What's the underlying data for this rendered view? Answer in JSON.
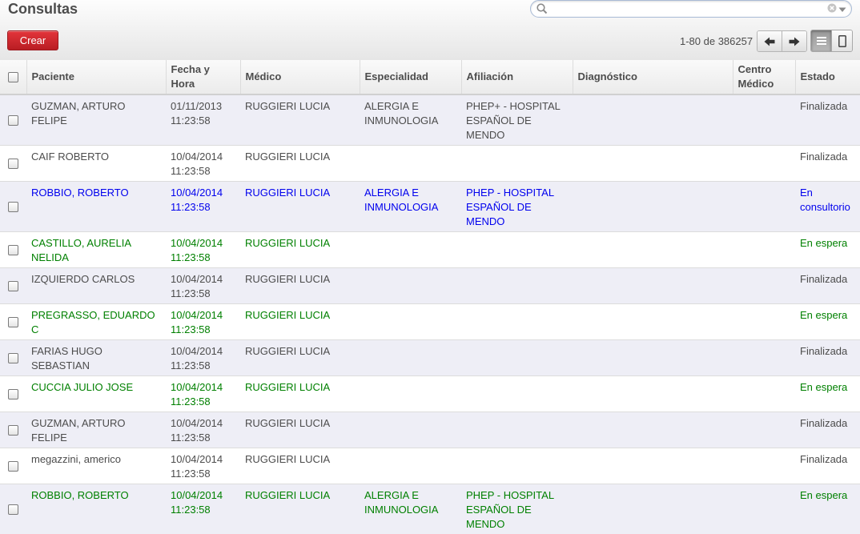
{
  "header": {
    "title": "Consultas",
    "create_label": "Crear",
    "pager": "1-80 de 386257"
  },
  "search": {
    "value": "",
    "placeholder": ""
  },
  "columns": [
    "Paciente",
    "Fecha y Hora",
    "Médico",
    "Especialidad",
    "Afiliación",
    "Diagnóstico",
    "Centro Médico",
    "Estado"
  ],
  "colors": {
    "finalizada": "#4c4c4c",
    "en_consultorio": "#0000ee",
    "en_espera": "#008000",
    "create_button": "#c9272d"
  },
  "rows": [
    {
      "paciente": "GUZMAN, ARTURO FELIPE",
      "fecha": "01/11/2013 11:23:58",
      "medico": "RUGGIERI LUCIA",
      "especialidad": "ALERGIA E INMUNOLOGIA",
      "afiliacion": "PHEP+ - HOSPITAL ESPAÑOL DE MENDO",
      "diagnostico": "",
      "centro": "",
      "estado": "Finalizada"
    },
    {
      "paciente": "CAIF ROBERTO",
      "fecha": "10/04/2014 11:23:58",
      "medico": "RUGGIERI LUCIA",
      "especialidad": "",
      "afiliacion": "",
      "diagnostico": "",
      "centro": "",
      "estado": "Finalizada"
    },
    {
      "paciente": "ROBBIO, ROBERTO",
      "fecha": "10/04/2014 11:23:58",
      "medico": "RUGGIERI LUCIA",
      "especialidad": "ALERGIA E INMUNOLOGIA",
      "afiliacion": "PHEP - HOSPITAL ESPAÑOL DE MENDO",
      "diagnostico": "",
      "centro": "",
      "estado": "En consultorio"
    },
    {
      "paciente": "CASTILLO, AURELIA NELIDA",
      "fecha": "10/04/2014 11:23:58",
      "medico": "RUGGIERI LUCIA",
      "especialidad": "",
      "afiliacion": "",
      "diagnostico": "",
      "centro": "",
      "estado": "En espera"
    },
    {
      "paciente": "IZQUIERDO CARLOS",
      "fecha": "10/04/2014 11:23:58",
      "medico": "RUGGIERI LUCIA",
      "especialidad": "",
      "afiliacion": "",
      "diagnostico": "",
      "centro": "",
      "estado": "Finalizada"
    },
    {
      "paciente": "PREGRASSO, EDUARDO C",
      "fecha": "10/04/2014 11:23:58",
      "medico": "RUGGIERI LUCIA",
      "especialidad": "",
      "afiliacion": "",
      "diagnostico": "",
      "centro": "",
      "estado": "En espera"
    },
    {
      "paciente": "FARIAS HUGO SEBASTIAN",
      "fecha": "10/04/2014 11:23:58",
      "medico": "RUGGIERI LUCIA",
      "especialidad": "",
      "afiliacion": "",
      "diagnostico": "",
      "centro": "",
      "estado": "Finalizada"
    },
    {
      "paciente": "CUCCIA JULIO JOSE",
      "fecha": "10/04/2014 11:23:58",
      "medico": "RUGGIERI LUCIA",
      "especialidad": "",
      "afiliacion": "",
      "diagnostico": "",
      "centro": "",
      "estado": "En espera"
    },
    {
      "paciente": "GUZMAN, ARTURO FELIPE",
      "fecha": "10/04/2014 11:23:58",
      "medico": "RUGGIERI LUCIA",
      "especialidad": "",
      "afiliacion": "",
      "diagnostico": "",
      "centro": "",
      "estado": "Finalizada"
    },
    {
      "paciente": "megazzini, americo",
      "fecha": "10/04/2014 11:23:58",
      "medico": "RUGGIERI LUCIA",
      "especialidad": "",
      "afiliacion": "",
      "diagnostico": "",
      "centro": "",
      "estado": "Finalizada"
    },
    {
      "paciente": "ROBBIO, ROBERTO",
      "fecha": "10/04/2014 11:23:58",
      "medico": "RUGGIERI LUCIA",
      "especialidad": "ALERGIA E INMUNOLOGIA",
      "afiliacion": "PHEP - HOSPITAL ESPAÑOL DE MENDO",
      "diagnostico": "",
      "centro": "",
      "estado": "En espera"
    }
  ]
}
